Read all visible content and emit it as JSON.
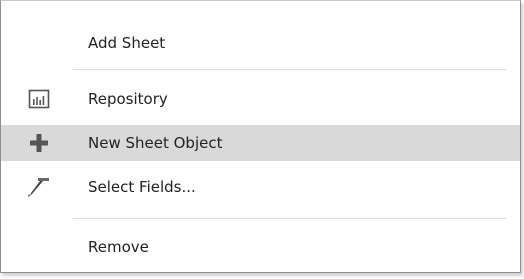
{
  "context_menu": {
    "items": [
      {
        "label": "Add Sheet",
        "icon": "none",
        "highlighted": false
      },
      {
        "label": "Repository",
        "icon": "bar-chart-icon",
        "highlighted": false
      },
      {
        "label": "New Sheet Object",
        "icon": "plus-icon",
        "highlighted": true
      },
      {
        "label": "Select Fields...",
        "icon": "select-fields-icon",
        "highlighted": false
      },
      {
        "label": "Remove",
        "icon": "none",
        "highlighted": false
      }
    ],
    "highlight_color": "#d9d9d9",
    "icon_color": "#555555"
  }
}
